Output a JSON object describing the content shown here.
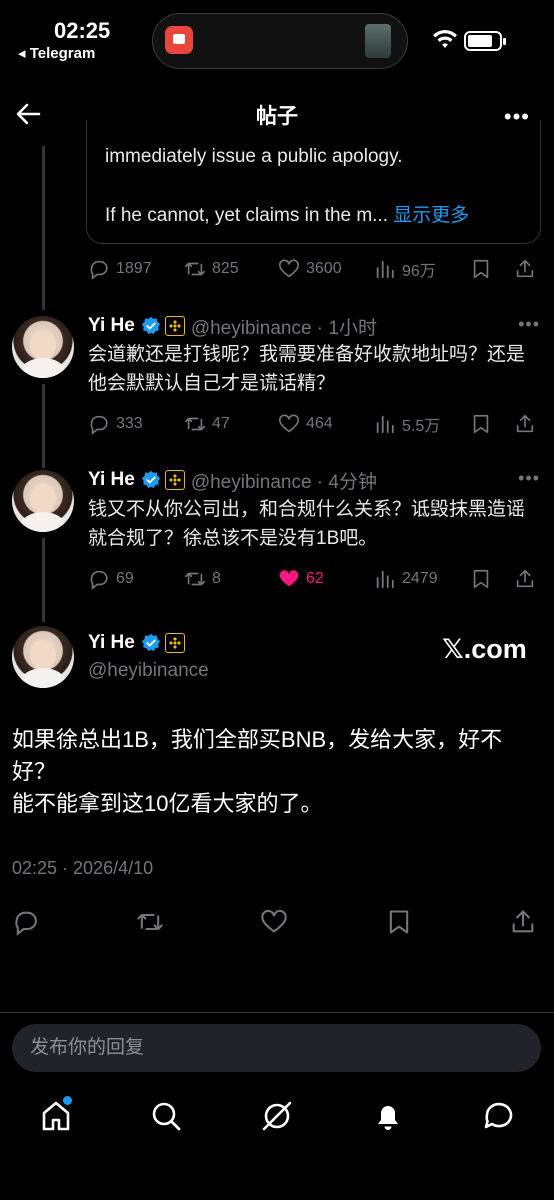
{
  "status_bar": {
    "time": "02:25",
    "back_app": "Telegram"
  },
  "header": {
    "title": "帖子"
  },
  "quote": {
    "line1": "immediately issue a public apology.",
    "line2": "If he cannot, yet claims in the m...",
    "show_more": "显示更多"
  },
  "quote_stats": {
    "replies": "1897",
    "reposts": "825",
    "likes": "3600",
    "views": "96万"
  },
  "posts": [
    {
      "name": "Yi He",
      "handle": "@heyibinance · 1小时",
      "text": "会道歉还是打钱呢？我需要准备好收款地址吗？还是他会默默认自己才是谎话精？",
      "replies": "333",
      "reposts": "47",
      "likes": "464",
      "views": "5.5万",
      "liked": false
    },
    {
      "name": "Yi He",
      "handle": "@heyibinance · 4分钟",
      "text": "钱又不从你公司出，和合规什么关系？诋毁抹黑造谣就合规了？徐总该不是没有1B吧。",
      "replies": "69",
      "reposts": "8",
      "likes": "62",
      "views": "2479",
      "liked": true
    }
  ],
  "main_post": {
    "name": "Yi He",
    "handle": "@heyibinance",
    "watermark": "𝕏.com",
    "text_line1": "如果徐总出1B，我们全部买BNB，发给大家，好不好？",
    "text_line2": "能不能拿到这10亿看大家的了。",
    "timestamp": "02:25 · 2026/4/10"
  },
  "reply": {
    "placeholder": "发布你的回复"
  },
  "colors": {
    "accent": "#1d9bf0",
    "like": "#f91880",
    "muted": "#71767b",
    "bnb": "#f0b90b"
  }
}
